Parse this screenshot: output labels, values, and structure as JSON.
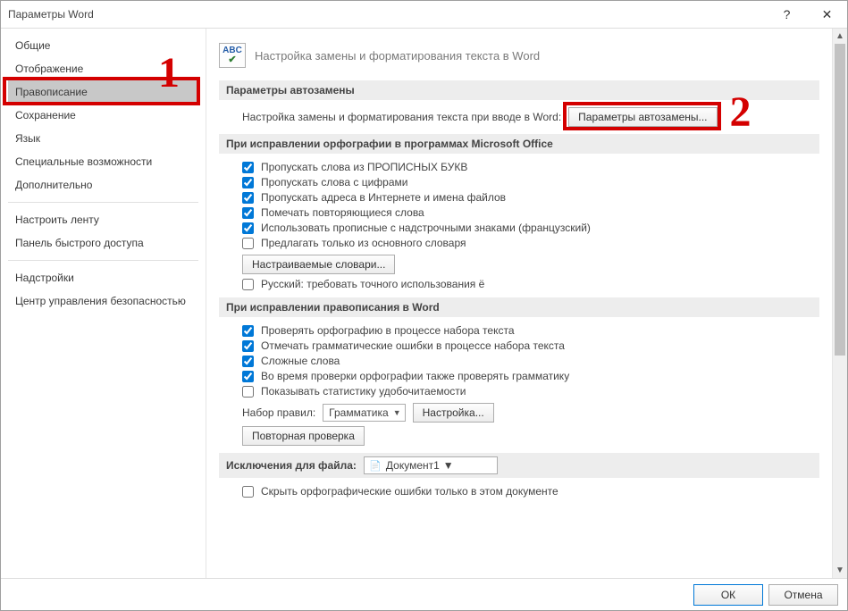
{
  "window": {
    "title": "Параметры Word"
  },
  "titlebar_buttons": {
    "help": "?",
    "close": "✕"
  },
  "sidebar": {
    "groups": [
      [
        "Общие",
        "Отображение",
        "Правописание",
        "Сохранение",
        "Язык",
        "Специальные возможности",
        "Дополнительно"
      ],
      [
        "Настроить ленту",
        "Панель быстрого доступа"
      ],
      [
        "Надстройки",
        "Центр управления безопасностью"
      ]
    ],
    "selected": "Правописание"
  },
  "heading": {
    "icon_top": "ABC",
    "icon_bottom": "✔",
    "text": "Настройка замены и форматирования текста в Word"
  },
  "section_autocorrect": {
    "title": "Параметры автозамены",
    "prompt": "Настройка замены и форматирования текста при вводе в Word:",
    "button": "Параметры автозамены..."
  },
  "section_office_spelling": {
    "title": "При исправлении орфографии в программах Microsoft Office",
    "items": [
      {
        "checked": true,
        "label": "Пропускать слова из ПРОПИСНЫХ БУКВ"
      },
      {
        "checked": true,
        "label": "Пропускать слова с цифрами"
      },
      {
        "checked": true,
        "label": "Пропускать адреса в Интернете и имена файлов"
      },
      {
        "checked": true,
        "label": "Помечать повторяющиеся слова"
      },
      {
        "checked": true,
        "label": "Использовать прописные с надстрочными знаками (французский)"
      },
      {
        "checked": false,
        "label": "Предлагать только из основного словаря"
      }
    ],
    "dict_button": "Настраиваемые словари...",
    "russian_yo": {
      "checked": false,
      "label": "Русский: требовать точного использования ё"
    }
  },
  "section_word_grammar": {
    "title": "При исправлении правописания в Word",
    "items": [
      {
        "checked": true,
        "label": "Проверять орфографию в процессе набора текста"
      },
      {
        "checked": true,
        "label": "Отмечать грамматические ошибки в процессе набора текста"
      },
      {
        "checked": true,
        "label": "Сложные слова"
      },
      {
        "checked": true,
        "label": "Во время проверки орфографии также проверять грамматику"
      },
      {
        "checked": false,
        "label": "Показывать статистику удобочитаемости"
      }
    ],
    "ruleset_label": "Набор правил:",
    "ruleset_value": "Грамматика",
    "settings_button": "Настройка...",
    "recheck_button": "Повторная проверка"
  },
  "section_exceptions": {
    "title": "Исключения для файла:",
    "doc_value": "Документ1",
    "hide_spelling": {
      "checked": false,
      "label": "Скрыть орфографические ошибки только в этом документе"
    }
  },
  "footer": {
    "ok": "ОК",
    "cancel": "Отмена"
  },
  "annotations": {
    "n1": "1",
    "n2": "2"
  }
}
